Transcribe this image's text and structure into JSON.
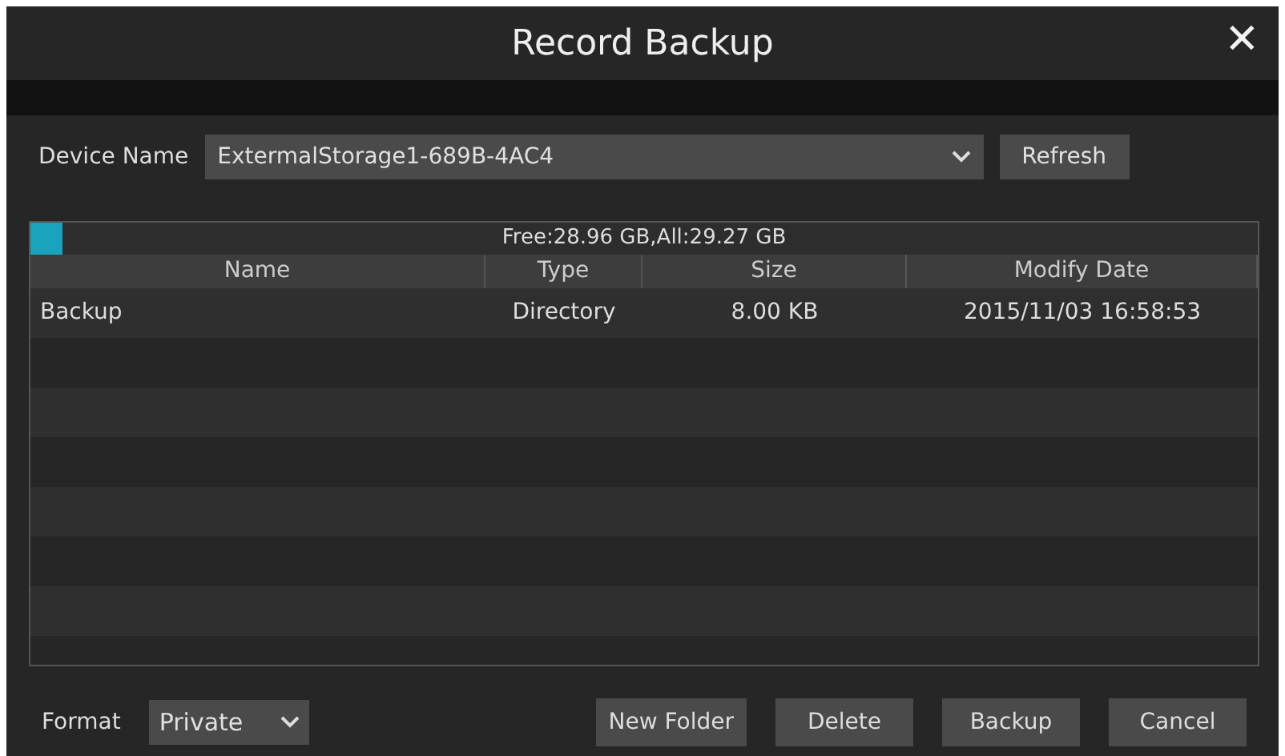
{
  "window": {
    "title": "Record Backup",
    "close": "✕"
  },
  "device": {
    "label": "Device Name",
    "value": "ExtermalStorage1-689B-4AC4",
    "refresh": "Refresh"
  },
  "storage": {
    "text": "Free:28.96 GB,All:29.27 GB",
    "level": 0.026
  },
  "table": {
    "columns": [
      "Name",
      "Type",
      "Size",
      "Modify Date"
    ],
    "rows": [
      [
        "Backup",
        "Directory",
        "8.00 KB",
        "2015/11/03 16:58:53"
      ]
    ]
  },
  "format": {
    "label": "Format",
    "value": "Private"
  },
  "buttons": [
    "New Folder",
    "Delete",
    "Backup",
    "Cancel"
  ]
}
